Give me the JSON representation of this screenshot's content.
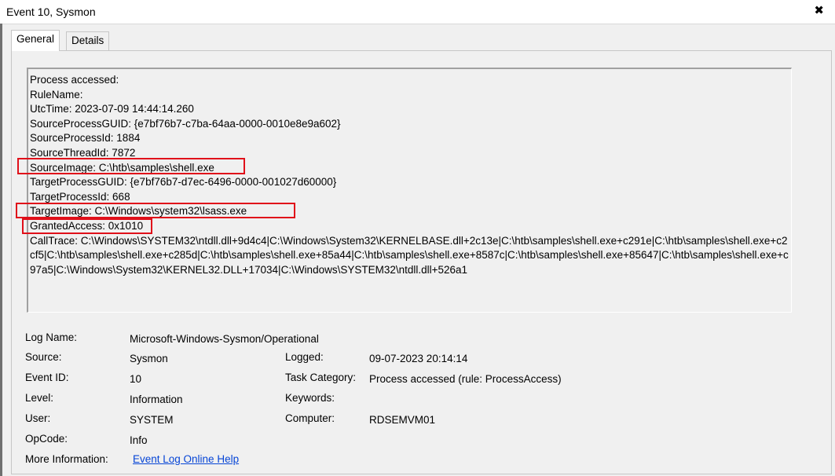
{
  "window": {
    "title": "Event 10, Sysmon",
    "close_glyph": "✖"
  },
  "tabs": [
    {
      "label": "General",
      "active": true
    },
    {
      "label": "Details",
      "active": false
    }
  ],
  "event_text": {
    "lines": [
      "Process accessed:",
      "RuleName:",
      "UtcTime: 2023-07-09 14:44:14.260",
      "SourceProcessGUID: {e7bf76b7-c7ba-64aa-0000-0010e8e9a602}",
      "SourceProcessId: 1884",
      "SourceThreadId: 7872",
      "SourceImage: C:\\htb\\samples\\shell.exe",
      "TargetProcessGUID: {e7bf76b7-d7ec-6496-0000-001027d60000}",
      "TargetProcessId: 668",
      "TargetImage: C:\\Windows\\system32\\lsass.exe",
      "GrantedAccess: 0x1010",
      "CallTrace: C:\\Windows\\SYSTEM32\\ntdll.dll+9d4c4|C:\\Windows\\System32\\KERNELBASE.dll+2c13e|C:\\htb\\samples\\shell.exe+c291e|C:\\htb\\samples\\shell.exe+c2cf5|C:\\htb\\samples\\shell.exe+c285d|C:\\htb\\samples\\shell.exe+85a44|C:\\htb\\samples\\shell.exe+8587c|C:\\htb\\samples\\shell.exe+85647|C:\\htb\\samples\\shell.exe+c97a5|C:\\Windows\\System32\\KERNEL32.DLL+17034|C:\\Windows\\SYSTEM32\\ntdll.dll+526a1"
    ],
    "highlight_color": "#e0101a"
  },
  "details": {
    "log_name_label": "Log Name:",
    "log_name_value": "Microsoft-Windows-Sysmon/Operational",
    "source_label": "Source:",
    "source_value": "Sysmon",
    "logged_label": "Logged:",
    "logged_value": "09-07-2023 20:14:14",
    "event_id_label": "Event ID:",
    "event_id_value": "10",
    "task_category_label": "Task Category:",
    "task_category_value": "Process accessed (rule: ProcessAccess)",
    "level_label": "Level:",
    "level_value": "Information",
    "keywords_label": "Keywords:",
    "keywords_value": "",
    "user_label": "User:",
    "user_value": "SYSTEM",
    "computer_label": "Computer:",
    "computer_value": "RDSEMVM01",
    "opcode_label": "OpCode:",
    "opcode_value": "Info",
    "more_info_label": "More Information:",
    "more_info_link": "Event Log Online Help",
    "link_color": "#0645d6"
  }
}
